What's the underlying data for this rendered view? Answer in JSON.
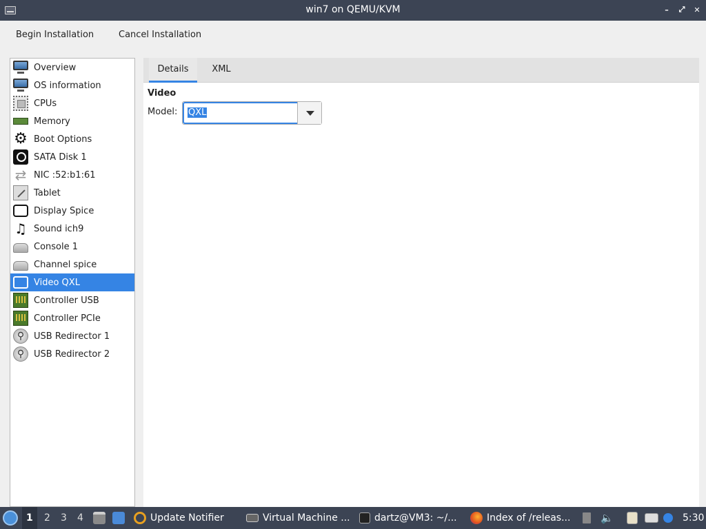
{
  "window": {
    "title": "win7 on QEMU/KVM",
    "controls": {
      "minimize": "–",
      "maximize": "⤢",
      "close": "✕"
    }
  },
  "toolbar": {
    "begin_label": "Begin Installation",
    "cancel_label": "Cancel Installation"
  },
  "sidebar": {
    "selected": "Video QXL",
    "items": [
      {
        "label": "Overview",
        "icon": "monitor-icon"
      },
      {
        "label": "OS information",
        "icon": "monitor-icon"
      },
      {
        "label": "CPUs",
        "icon": "cpu-icon"
      },
      {
        "label": "Memory",
        "icon": "memory-icon"
      },
      {
        "label": "Boot Options",
        "icon": "gear-icon"
      },
      {
        "label": "SATA Disk 1",
        "icon": "disk-icon"
      },
      {
        "label": "NIC :52:b1:61",
        "icon": "network-icon"
      },
      {
        "label": "Tablet",
        "icon": "tablet-icon"
      },
      {
        "label": "Display Spice",
        "icon": "display-icon"
      },
      {
        "label": "Sound ich9",
        "icon": "sound-icon"
      },
      {
        "label": "Console 1",
        "icon": "console-icon"
      },
      {
        "label": "Channel spice",
        "icon": "channel-icon"
      },
      {
        "label": "Video QXL",
        "icon": "video-icon"
      },
      {
        "label": "Controller USB",
        "icon": "pci-controller-icon"
      },
      {
        "label": "Controller PCIe",
        "icon": "pci-controller-icon"
      },
      {
        "label": "USB Redirector 1",
        "icon": "usb-icon"
      },
      {
        "label": "USB Redirector 2",
        "icon": "usb-icon"
      }
    ]
  },
  "main": {
    "tabs": [
      {
        "label": "Details",
        "active": true
      },
      {
        "label": "XML",
        "active": false
      }
    ],
    "section_title": "Video",
    "model_label": "Model:",
    "model_value": "QXL"
  },
  "taskbar": {
    "desktops": [
      "1",
      "2",
      "3",
      "4"
    ],
    "active_desktop": "1",
    "tasks": [
      {
        "label": "Update Notifier",
        "icon": "update-notifier-icon"
      },
      {
        "label": "Virtual Machine ...",
        "icon": "virt-manager-icon"
      },
      {
        "label": "dartz@VM3: ~/...",
        "icon": "terminal-icon"
      },
      {
        "label": "Index of /releas...",
        "icon": "firefox-icon"
      }
    ],
    "clock": "5:30"
  },
  "colors": {
    "accent": "#3584e4",
    "titlebar": "#3c4454",
    "taskbar": "#3c4454",
    "window_bg": "#efefef"
  }
}
